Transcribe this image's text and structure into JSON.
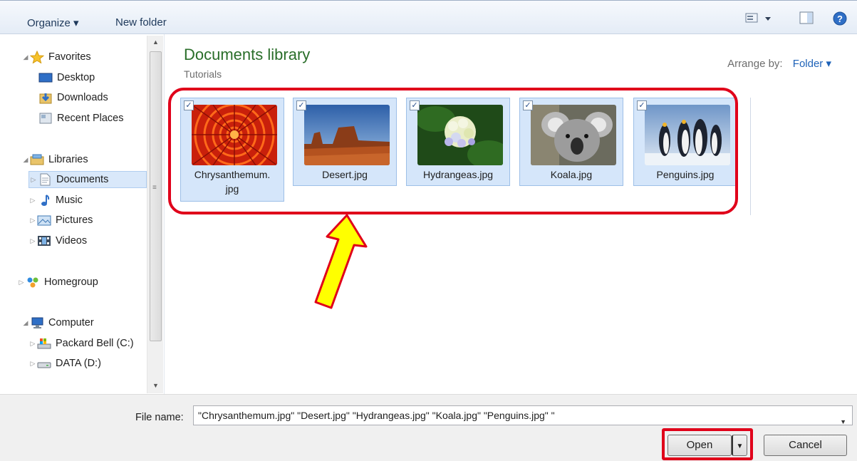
{
  "toolbar": {
    "organize": "Organize ▾",
    "new_folder": "New folder"
  },
  "sidebar": {
    "favorites": "Favorites",
    "desktop": "Desktop",
    "downloads": "Downloads",
    "recent_places": "Recent Places",
    "libraries": "Libraries",
    "documents": "Documents",
    "music": "Music",
    "pictures": "Pictures",
    "videos": "Videos",
    "homegroup": "Homegroup",
    "computer": "Computer",
    "drive_c": "Packard Bell (C:)",
    "drive_d": "DATA (D:)"
  },
  "main": {
    "title": "Documents library",
    "subtitle": "Tutorials",
    "arrange_label": "Arrange by:",
    "arrange_value": "Folder ▾",
    "files": [
      {
        "name": "Chrysanthemum.jpg",
        "line1": "Chrysanthemum.",
        "line2": "jpg",
        "checked": true
      },
      {
        "name": "Desert.jpg",
        "checked": true
      },
      {
        "name": "Hydrangeas.jpg",
        "checked": true
      },
      {
        "name": "Koala.jpg",
        "checked": true
      },
      {
        "name": "Penguins.jpg",
        "checked": true
      }
    ]
  },
  "bottom": {
    "file_name_label": "File name:",
    "file_name_value": "\"Chrysanthemum.jpg\" \"Desert.jpg\" \"Hydrangeas.jpg\" \"Koala.jpg\" \"Penguins.jpg\" \"",
    "open": "Open",
    "cancel": "Cancel"
  },
  "colors": {
    "accent_red": "#e0001a",
    "title_green": "#2a6e2a",
    "selection_blue": "#d5e6fa",
    "arrow_yellow": "#ffff00"
  }
}
